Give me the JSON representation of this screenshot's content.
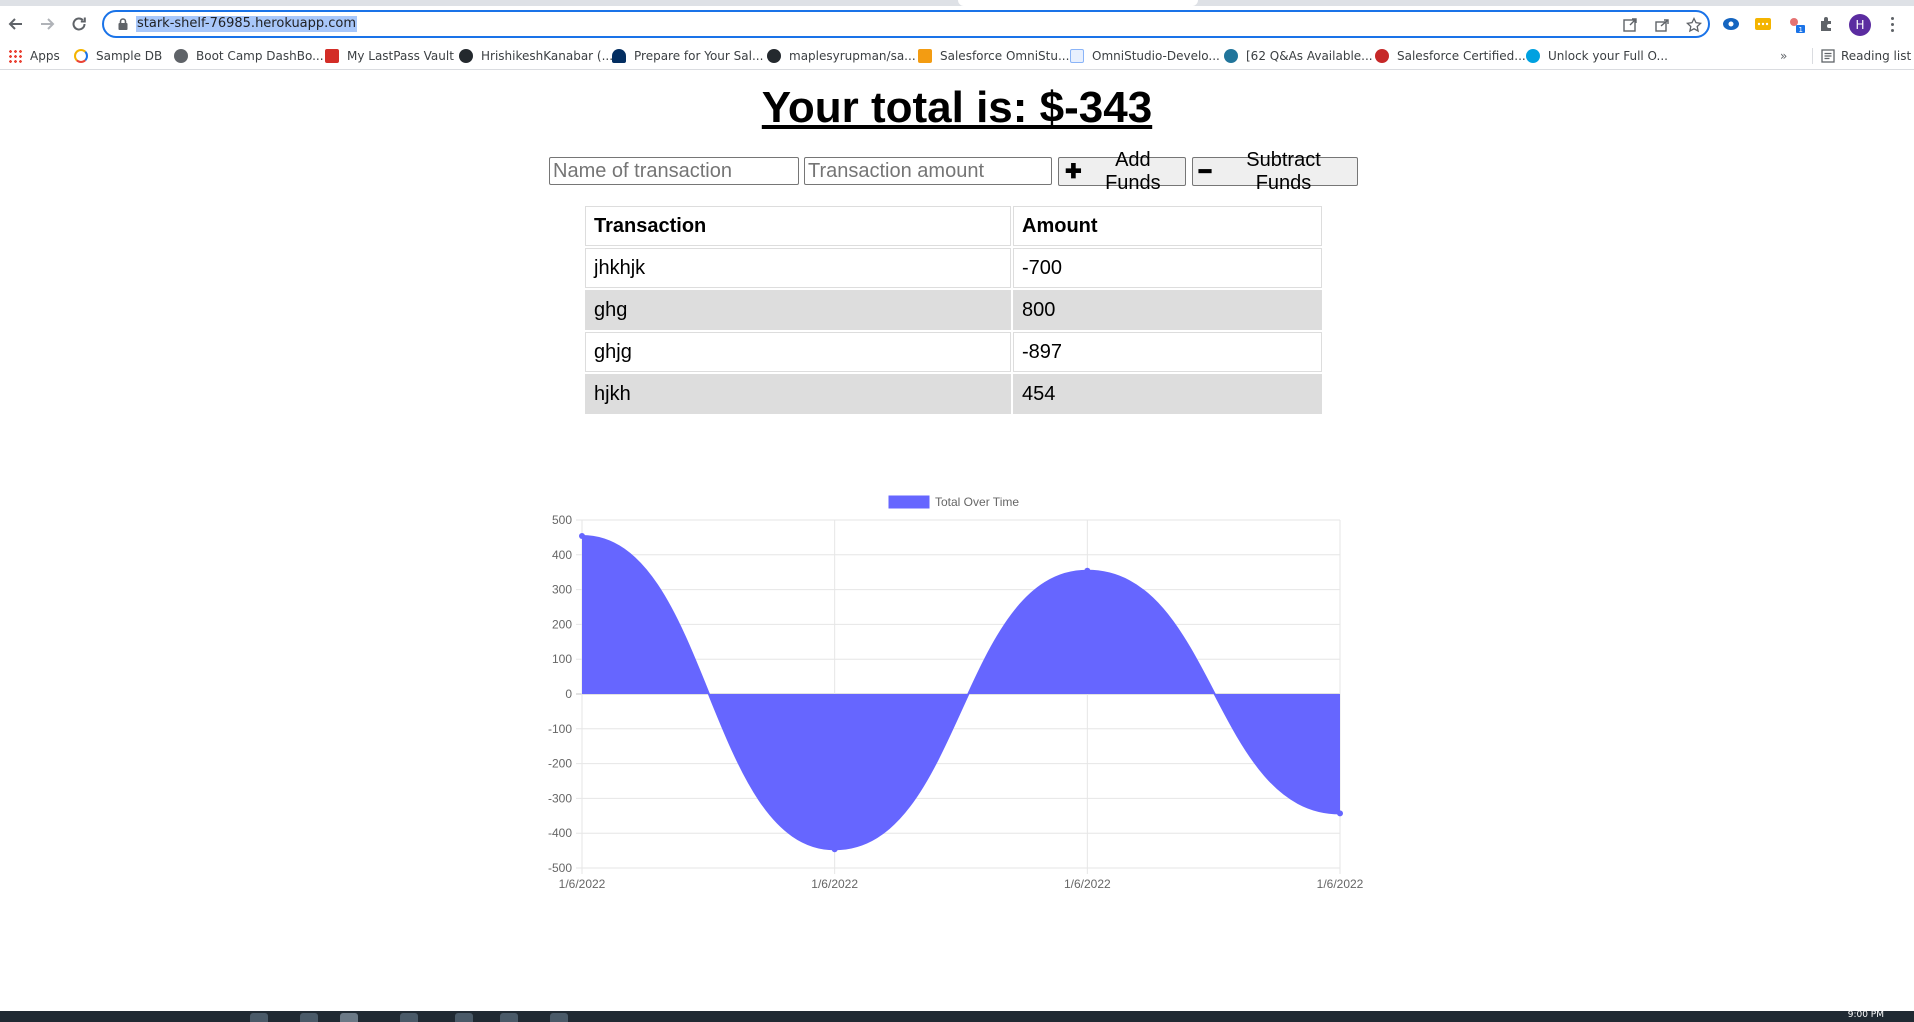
{
  "browser": {
    "url": "stark-shelf-76985.herokuapp.com",
    "profile_initial": "H",
    "bookmarks": [
      {
        "label": "Apps",
        "icon": "apps-grid-icon",
        "color": "#ea4335"
      },
      {
        "label": "Sample DB",
        "icon": "sample-db-icon",
        "color": "#f4b400"
      },
      {
        "label": "Boot Camp DashBo...",
        "icon": "globe-icon",
        "color": "#5f6368"
      },
      {
        "label": "My LastPass Vault",
        "icon": "lastpass-icon",
        "color": "#d32d27"
      },
      {
        "label": "HrishikeshKanabar (...",
        "icon": "github-icon",
        "color": "#24292e"
      },
      {
        "label": "Prepare for Your Sal...",
        "icon": "trailhead-icon",
        "color": "#032e61"
      },
      {
        "label": "maplesyrupman/sa...",
        "icon": "github-icon",
        "color": "#24292e"
      },
      {
        "label": "Salesforce OmniStu...",
        "icon": "omnistudio-icon",
        "color": "#f39c12"
      },
      {
        "label": "OmniStudio-Develo...",
        "icon": "document-icon",
        "color": "#8ab4f8"
      },
      {
        "label": "[62 Q&As Available...",
        "icon": "wordpress-icon",
        "color": "#21759b"
      },
      {
        "label": "Salesforce Certified...",
        "icon": "certification-icon",
        "color": "#c62828"
      },
      {
        "label": "Unlock your Full O...",
        "icon": "salesforce-icon",
        "color": "#00a1e0"
      }
    ],
    "more_label": "»",
    "reading_list_label": "Reading list"
  },
  "page": {
    "total_text": "Your total is: $-343",
    "name_placeholder": "Name of transaction",
    "amount_placeholder": "Transaction amount",
    "add_label": "Add Funds",
    "subtract_label": "Subtract Funds",
    "add_icon": "plus-icon",
    "subtract_icon": "minus-icon"
  },
  "table": {
    "headers": [
      "Transaction",
      "Amount"
    ],
    "rows": [
      {
        "name": "jhkhjk",
        "amount": "-700"
      },
      {
        "name": "ghg",
        "amount": "800"
      },
      {
        "name": "ghjg",
        "amount": "-897"
      },
      {
        "name": "hjkh",
        "amount": "454"
      }
    ]
  },
  "chart_data": {
    "type": "area",
    "legend": "Total Over Time",
    "legend_position": "top",
    "color": "#6666ff",
    "categories": [
      "1/6/2022",
      "1/6/2022",
      "1/6/2022",
      "1/6/2022"
    ],
    "series": [
      {
        "name": "Total Over Time",
        "values": [
          454,
          -446,
          354,
          -343
        ]
      }
    ],
    "ylim": [
      -500,
      500
    ],
    "yticks": [
      500,
      400,
      300,
      200,
      100,
      0,
      -100,
      -200,
      -300,
      -400,
      -500
    ],
    "grid": true
  },
  "system": {
    "clock_partial": "9:00 PM"
  }
}
